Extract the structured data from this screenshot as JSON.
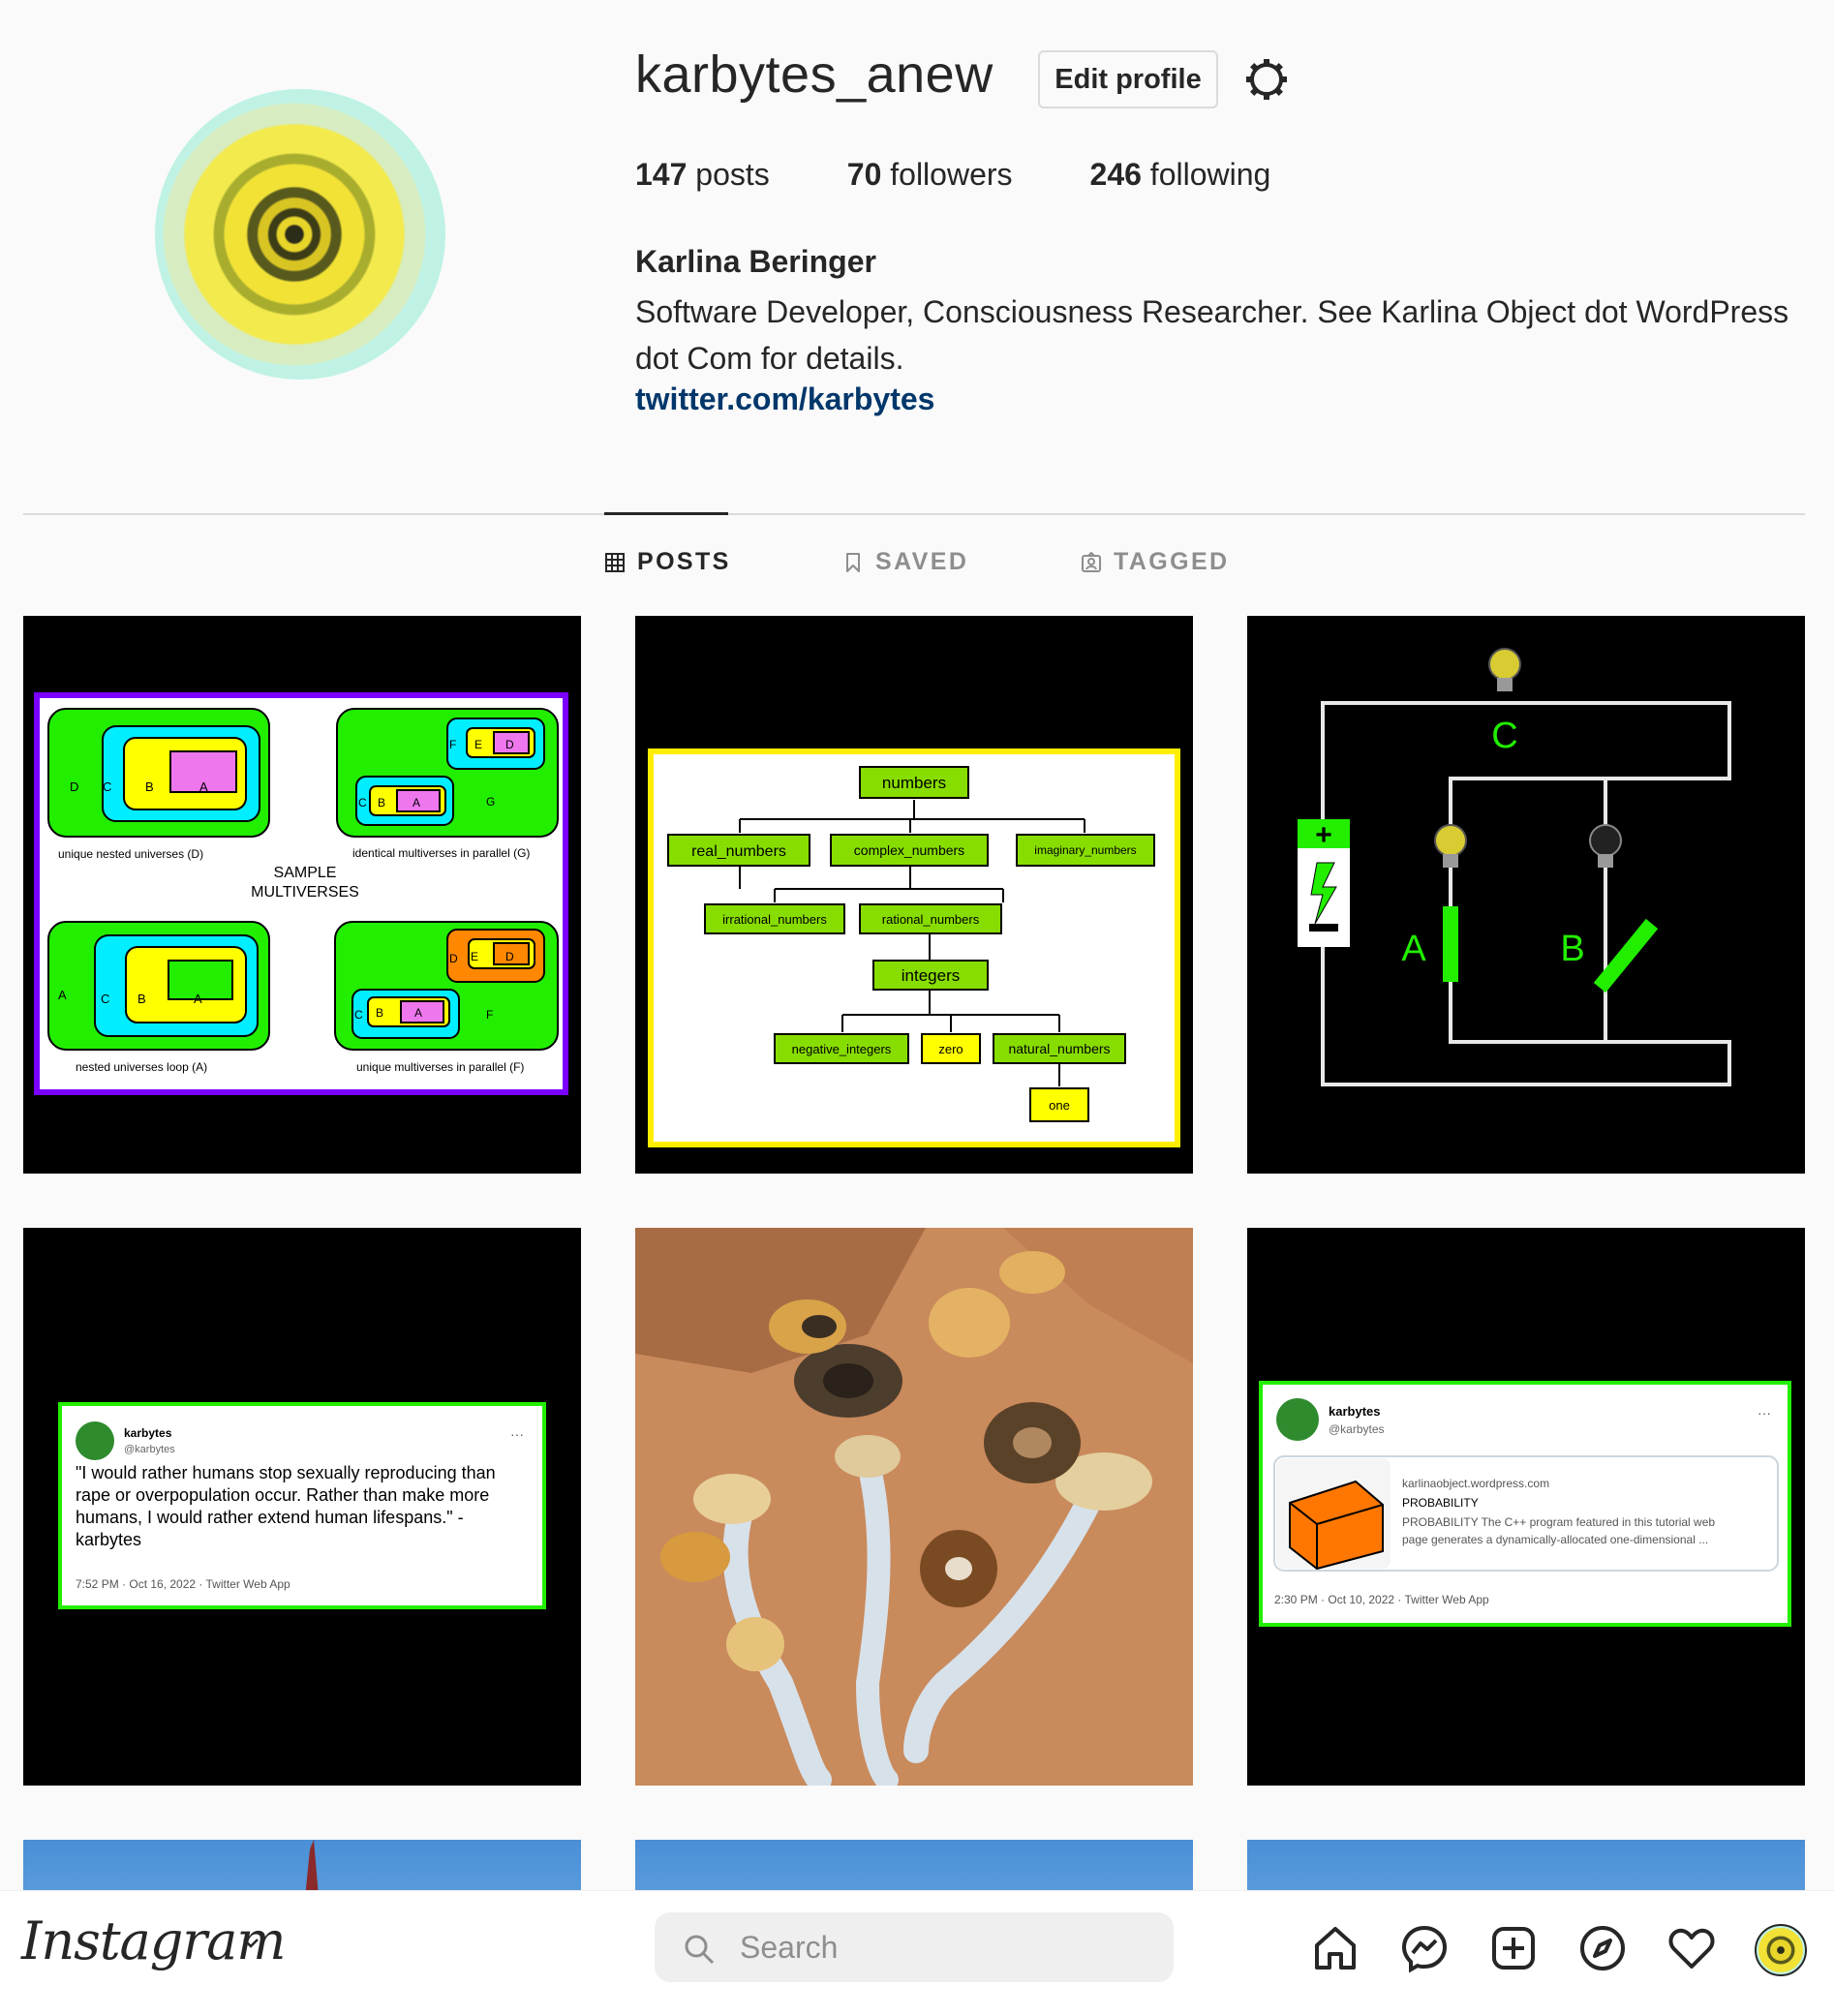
{
  "profile": {
    "username": "karbytes_anew",
    "edit_label": "Edit profile",
    "posts_count": "147",
    "posts_label": "posts",
    "followers_count": "70",
    "followers_label": "followers",
    "following_count": "246",
    "following_label": "following",
    "full_name": "Karlina Beringer",
    "bio": "Software Developer, Consciousness Researcher. See Karlina Object dot WordPress dot Com for details.",
    "link": "twitter.com/karbytes"
  },
  "tabs": [
    {
      "label": "POSTS",
      "icon": "grid-icon",
      "active": true
    },
    {
      "label": "SAVED",
      "icon": "bookmark-icon",
      "active": false
    },
    {
      "label": "TAGGED",
      "icon": "tagged-icon",
      "active": false
    }
  ],
  "posts": {
    "multiverse": {
      "title_1": "SAMPLE",
      "title_2": "MULTIVERSES",
      "cap_tl": "unique nested universes (D)",
      "cap_tr": "identical multiverses in parallel (G)",
      "cap_bl": "nested universes loop (A)",
      "cap_br": "unique multiverses in parallel (F)",
      "l_a": "A",
      "l_b": "B",
      "l_c": "C",
      "l_d": "D",
      "l_e": "E",
      "l_f": "F",
      "l_g": "G"
    },
    "numbers": {
      "root": "numbers",
      "real": "real_numbers",
      "complex": "complex_numbers",
      "imaginary": "imaginary_numbers",
      "irrational": "irrational_numbers",
      "rational": "rational_numbers",
      "integers": "integers",
      "negative": "negative_integers",
      "zero": "zero",
      "natural": "natural_numbers",
      "one": "one"
    },
    "circuit": {
      "label_a": "A",
      "label_b": "B",
      "label_c": "C"
    },
    "tweet1": {
      "name": "karbytes",
      "handle": "@karbytes",
      "more": "···",
      "text": "\"I would rather humans stop sexually reproducing than rape or overpopulation occur. Rather than make more humans, I would rather extend human lifespans.\" - karbytes",
      "meta": "7:52 PM · Oct 16, 2022 · Twitter Web App"
    },
    "tweet2": {
      "name": "karbytes",
      "handle": "@karbytes",
      "more": "···",
      "card_domain": "karlinaobject.wordpress.com",
      "card_title": "PROBABILITY",
      "card_desc_1": "PROBABILITY The C++ program featured in this tutorial web",
      "card_desc_2": "page generates a dynamically-allocated one-dimensional ...",
      "meta": "2:30 PM · Oct 10, 2022 · Twitter Web App"
    }
  },
  "bottom_nav": {
    "logo": "Instagram",
    "search_placeholder": "Search"
  },
  "colors": {
    "link": "#00376b",
    "green": "#22ee00",
    "cyan": "#00eeff",
    "yellow": "#ffff00",
    "pink": "#ee77ee",
    "purple": "#7700ff"
  }
}
